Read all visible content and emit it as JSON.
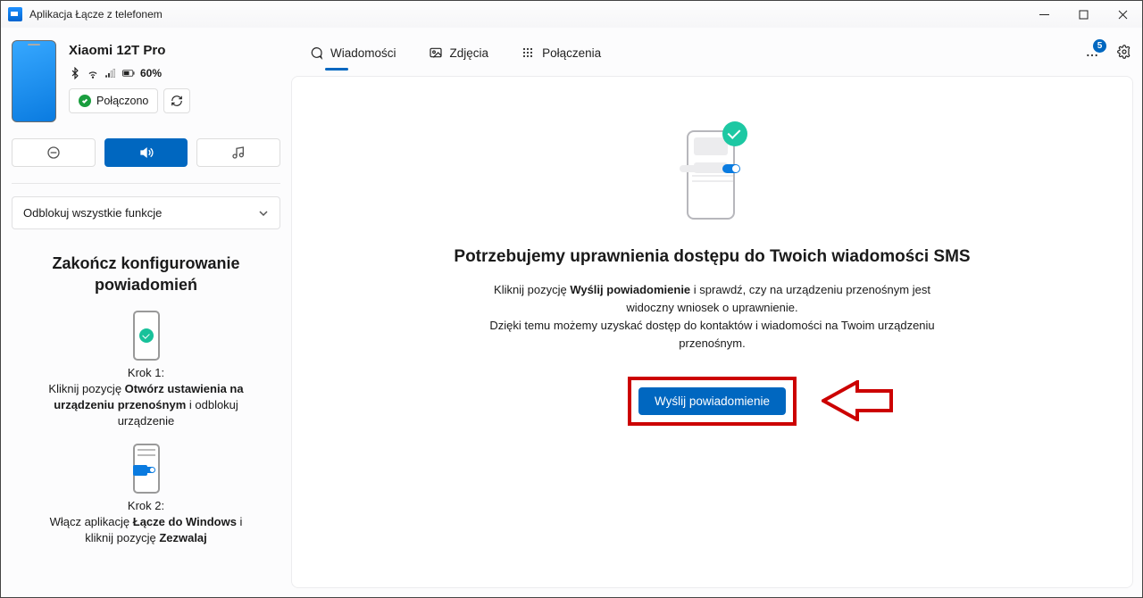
{
  "titlebar": {
    "title": "Aplikacja Łącze z telefonem"
  },
  "phone": {
    "name": "Xiaomi 12T Pro",
    "battery_text": "60%",
    "connected_label": "Połączono"
  },
  "sidebar": {
    "unlock_label": "Odblokuj wszystkie funkcje",
    "setup_title": "Zakończ konfigurowanie powiadomień",
    "step1_label": "Krok 1:",
    "step1_a": "Kliknij pozycję ",
    "step1_b": "Otwórz ustawienia na urządzeniu przenośnym",
    "step1_c": " i odblokuj urządzenie",
    "step2_label": "Krok 2:",
    "step2_a": "Włącz aplikację ",
    "step2_b": "Łącze do Windows",
    "step2_c": " i kliknij pozycję ",
    "step2_d": "Zezwalaj"
  },
  "tabs": {
    "messages": "Wiadomości",
    "photos": "Zdjęcia",
    "calls": "Połączenia",
    "badge": "5"
  },
  "main": {
    "heading": "Potrzebujemy uprawnienia dostępu do Twoich wiadomości SMS",
    "line1a": "Kliknij pozycję ",
    "line1b": "Wyślij powiadomienie",
    "line1c": " i sprawdź, czy na urządzeniu przenośnym jest widoczny wniosek o uprawnienie.",
    "line2": "Dzięki temu możemy uzyskać dostęp do kontaktów i wiadomości na Twoim urządzeniu przenośnym.",
    "cta_label": "Wyślij powiadomienie"
  }
}
